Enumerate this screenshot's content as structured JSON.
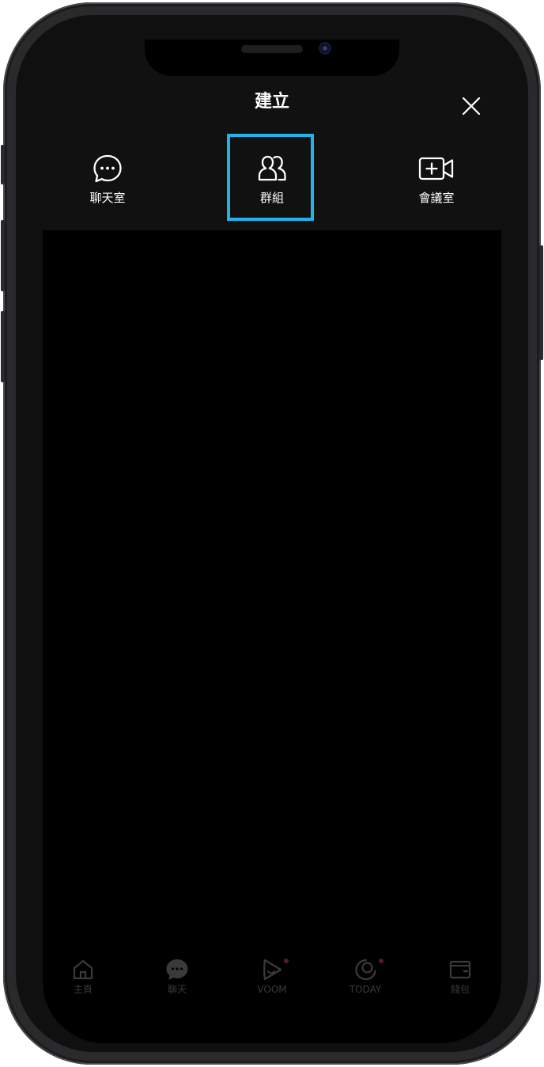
{
  "header": {
    "title": "建立"
  },
  "options": [
    {
      "label": "聊天室"
    },
    {
      "label": "群組"
    },
    {
      "label": "會議室"
    }
  ],
  "tabs": [
    {
      "label": "主頁"
    },
    {
      "label": "聊天"
    },
    {
      "label": "VOOM"
    },
    {
      "label": "TODAY"
    },
    {
      "label": "錢包"
    }
  ],
  "colors": {
    "highlight": "#1fb3ea",
    "sheet_background": "#111111",
    "screen_background": "#000000"
  }
}
